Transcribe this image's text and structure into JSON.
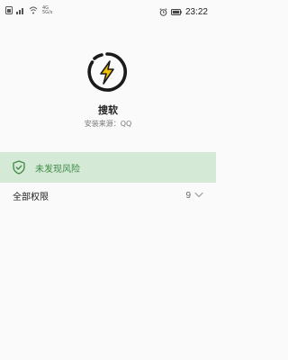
{
  "status_bar": {
    "left_signal_text": "",
    "network_top": "4G",
    "network_bottom": "5G/s",
    "time": "23:22"
  },
  "app": {
    "name": "搜软",
    "source": "安装来源：QQ",
    "icon": "lightning-icon",
    "accent_color": "#f2c200"
  },
  "risk": {
    "text": "未发现风险",
    "icon": "shield-check-icon",
    "color": "#3e8a46",
    "bg_color": "#d4e9d6"
  },
  "permissions": {
    "label": "全部权限",
    "count": "9",
    "icon": "chevron-down-icon"
  }
}
